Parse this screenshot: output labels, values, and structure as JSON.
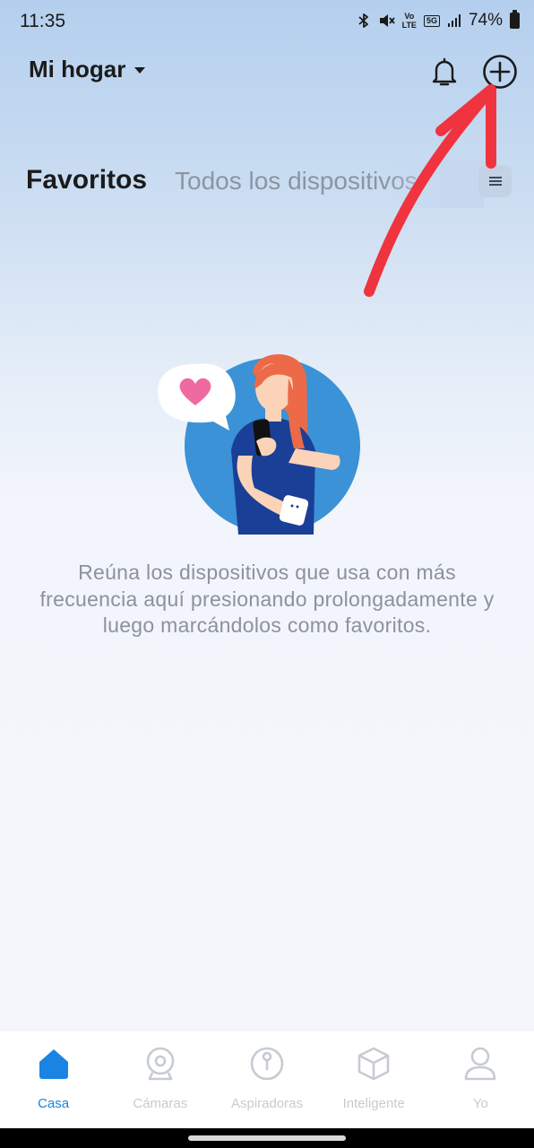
{
  "status": {
    "time": "11:35",
    "battery_text": "74%",
    "network_badge": "5G",
    "volte_top": "Vo",
    "volte_bottom": "LTE",
    "icons": [
      "bluetooth-icon",
      "mute-icon",
      "volte-icon",
      "5g-icon",
      "signal-icon",
      "battery-icon"
    ]
  },
  "header": {
    "home_title": "Mi hogar",
    "icons": [
      "caret-down-icon",
      "bell-icon",
      "add-circle-icon"
    ]
  },
  "tabs": {
    "favorites": "Favoritos",
    "all_devices": "Todos los dispositivos"
  },
  "empty_state": {
    "message": "Reúna los dispositivos que usa con más frecuencia aquí presionando prolongadamente y luego marcándolos como favoritos."
  },
  "bottom_nav": {
    "items": [
      {
        "label": "Casa",
        "icon": "home-icon",
        "active": true
      },
      {
        "label": "Cámaras",
        "icon": "camera-icon",
        "active": false
      },
      {
        "label": "Aspiradoras",
        "icon": "vacuum-icon",
        "active": false
      },
      {
        "label": "Inteligente",
        "icon": "cube-icon",
        "active": false
      },
      {
        "label": "Yo",
        "icon": "user-icon",
        "active": false
      }
    ]
  },
  "colors": {
    "accent": "#1b84e2",
    "annotation": "#f0343f",
    "inactive": "#c6cbd2"
  }
}
